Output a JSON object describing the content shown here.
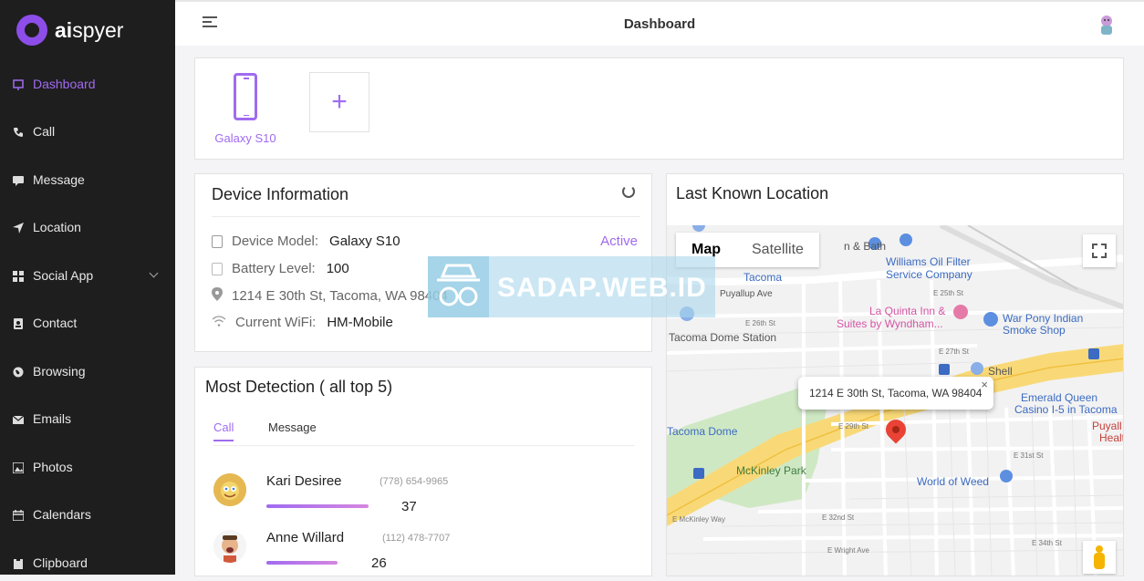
{
  "app": {
    "logo_ai": "ai",
    "logo_rest": "spyer"
  },
  "sidebar": {
    "items": [
      {
        "label": "Dashboard",
        "icon": "dashboard-icon",
        "active": true
      },
      {
        "label": "Call",
        "icon": "phone-icon"
      },
      {
        "label": "Message",
        "icon": "message-icon"
      },
      {
        "label": "Location",
        "icon": "location-arrow-icon"
      },
      {
        "label": "Social App",
        "icon": "grid-icon",
        "expandable": true
      },
      {
        "label": "Contact",
        "icon": "contact-icon"
      },
      {
        "label": "Browsing",
        "icon": "globe-icon"
      },
      {
        "label": "Emails",
        "icon": "email-icon"
      },
      {
        "label": "Photos",
        "icon": "photo-icon"
      },
      {
        "label": "Calendars",
        "icon": "calendar-icon"
      },
      {
        "label": "Clipboard",
        "icon": "clipboard-icon"
      }
    ]
  },
  "header": {
    "title": "Dashboard"
  },
  "devices": {
    "items": [
      {
        "name": "Galaxy S10"
      }
    ],
    "add_label": "+"
  },
  "device_info": {
    "title": "Device Information",
    "status": "Active",
    "rows": [
      {
        "label": "Device Model:",
        "value": "Galaxy S10"
      },
      {
        "label": "Battery Level:",
        "value": "100"
      },
      {
        "label": "1214 E 30th St, Tacoma, WA 98404",
        "value": ""
      },
      {
        "label": "Current WiFi:",
        "value": "HM-Mobile"
      }
    ]
  },
  "detection": {
    "title": "Most Detection ( all top 5)",
    "tabs": [
      "Call",
      "Message"
    ],
    "people": [
      {
        "name": "Kari Desiree",
        "phone": "(778) 654-9965",
        "count": "37"
      },
      {
        "name": "Anne Willard",
        "phone": "(112) 478-7707",
        "count": "26"
      }
    ]
  },
  "location": {
    "title": "Last Known Location",
    "map_toggle": [
      "Map",
      "Satellite"
    ],
    "popup": "1214 E 30th St, Tacoma, WA 98404",
    "popup_close": "×",
    "labels": {
      "williams": "Williams Oil Filter",
      "williams2": "Service Company",
      "tacoma": "Tacoma",
      "puyallup": "Puyallup Ave",
      "laquinta": "La Quinta Inn &",
      "laquinta2": "Suites by Wyndham...",
      "warpony": "War Pony Indian",
      "warpony2": "Smoke Shop",
      "dome_station": "Tacoma Dome Station",
      "shell": "Shell",
      "emerald": "Emerald Queen",
      "emerald2": "Casino I-5 in Tacoma",
      "tacoma_dome": "Tacoma Dome",
      "mckinley": "McKinley Park",
      "world_weed": "World of Weed",
      "puyall": "Puyall",
      "health": "Health",
      "bath": "n & Bath",
      "e25th": "E 25th St",
      "e26th": "E 26th St",
      "e27th": "E 27th St",
      "e29th": "E 29th St",
      "e31st": "E 31st St",
      "e32nd": "E 32nd St",
      "e34th": "E 34th St",
      "wright": "E Wright Ave",
      "mckinley_way": "E McKinley Way"
    }
  },
  "watermark": {
    "text": "SADAP.WEB.ID"
  },
  "colors": {
    "accent": "#a06bf0",
    "sidebar_bg": "#1e1e1e",
    "pin": "#ea4335"
  }
}
